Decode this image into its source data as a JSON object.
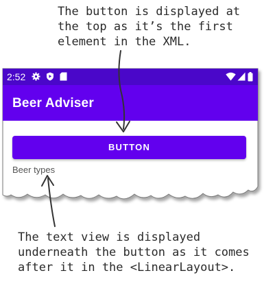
{
  "annotations": {
    "top": "The button is displayed at\nthe top as it’s the first\nelement in the XML.",
    "bottom": "The text view is displayed\nunderneath the button as it comes\nafter it in the <LinearLayout>."
  },
  "status_bar": {
    "time": "2:52",
    "icons": [
      "gear-icon",
      "shield-icon",
      "sd-card-icon",
      "wifi-icon",
      "signal-icon",
      "battery-icon"
    ],
    "color": "#4a07c9"
  },
  "app_bar": {
    "title": "Beer Adviser",
    "color": "#6200ee"
  },
  "main": {
    "button_label": "BUTTON",
    "text_view": "Beer types"
  }
}
